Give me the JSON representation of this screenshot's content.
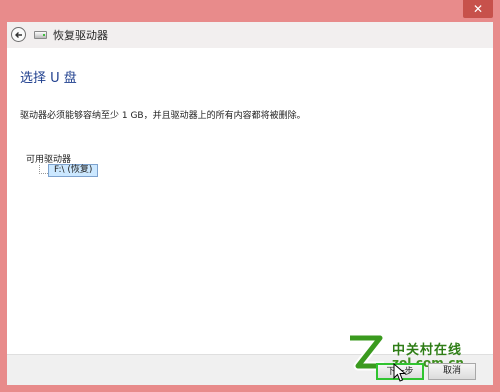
{
  "window": {
    "title": "恢复驱动器",
    "close_icon": "close-icon"
  },
  "content": {
    "page_title": "选择 U 盘",
    "description": "驱动器必须能够容纳至少 1 GB，并且驱动器上的所有内容都将被删除。",
    "drives_label": "可用驱动器",
    "drives": [
      {
        "label": "F:\\ (恢复)",
        "selected": true
      }
    ]
  },
  "footer": {
    "next_label": "下一步",
    "cancel_label": "取消"
  },
  "watermark": {
    "name": "中关村在线",
    "url": "zol.com.cn"
  },
  "colors": {
    "window_frame": "#e88b8b",
    "title_text": "#1f3f8e",
    "selection_bg": "#cce8ff",
    "highlight_border": "#31c431"
  }
}
